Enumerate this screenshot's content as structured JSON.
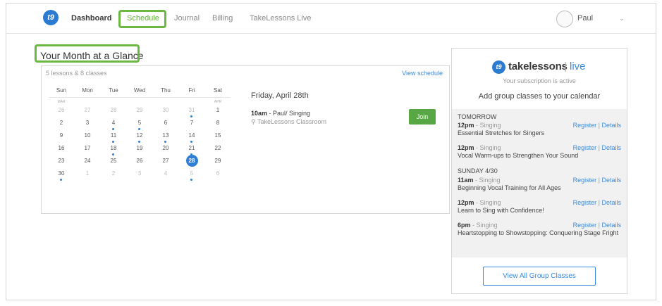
{
  "header": {
    "logo_text": "t9",
    "nav": [
      "Dashboard",
      "Schedule",
      "Journal",
      "Billing",
      "TakeLessons Live"
    ],
    "user": "Paul"
  },
  "main": {
    "title": "Your Month at a Glance",
    "summary": "5 lessons & 8 classes",
    "view_schedule": "View schedule",
    "weekdays": [
      "Sun",
      "Mon",
      "Tue",
      "Wed",
      "Thu",
      "Fri",
      "Sat"
    ],
    "month_labels": [
      "MAR",
      "APR"
    ],
    "weeks": [
      [
        "26",
        "27",
        "28",
        "29",
        "30",
        "31",
        "1"
      ],
      [
        "2",
        "3",
        "4",
        "5",
        "6",
        "7",
        "8"
      ],
      [
        "9",
        "10",
        "11",
        "12",
        "13",
        "14",
        "15"
      ],
      [
        "16",
        "17",
        "18",
        "19",
        "20",
        "21",
        "22"
      ],
      [
        "23",
        "24",
        "25",
        "26",
        "27",
        "28",
        "29"
      ],
      [
        "30",
        "1",
        "2",
        "3",
        "4",
        "5",
        "6"
      ]
    ],
    "selected_day_title": "Friday, April 28th",
    "event": {
      "time": "10am",
      "desc": " - Paul/ Singing",
      "location": "TakeLessons Classroom",
      "join_label": "Join"
    }
  },
  "side": {
    "brand_word": "takelessons",
    "brand_live": "live",
    "subscription": "Your subscription is active",
    "add_text": "Add group classes to your calendar",
    "groups": [
      {
        "heading": "TOMORROW",
        "classes": [
          {
            "time": "12pm",
            "subject": "Singing",
            "title": "Essential Stretches for Singers"
          },
          {
            "time": "12pm",
            "subject": "Singing",
            "title": "Vocal Warm-ups to Strengthen Your Sound"
          }
        ]
      },
      {
        "heading": "SUNDAY 4/30",
        "classes": [
          {
            "time": "11am",
            "subject": "Singing",
            "title": "Beginning Vocal Training for All Ages"
          },
          {
            "time": "12pm",
            "subject": "Singing",
            "title": "Learn to Sing with Confidence!"
          },
          {
            "time": "6pm",
            "subject": "Singing",
            "title": "Heartstopping to Showstopping: Conquering Stage Fright"
          }
        ]
      }
    ],
    "register_label": "Register",
    "details_label": "Details",
    "view_all": "View All Group Classes"
  },
  "colors": {
    "accent_blue": "#3a8be0",
    "highlight_green": "#6ab741",
    "join_green": "#57a844"
  }
}
